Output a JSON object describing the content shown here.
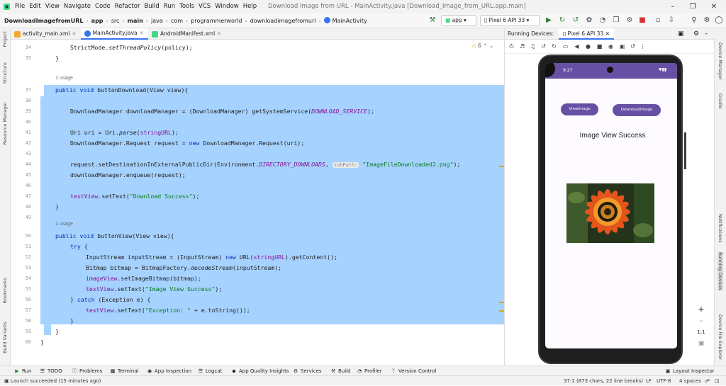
{
  "window": {
    "title": "Download Image from URL - MainActivity.java [Download_Image_from_URL.app.main]",
    "menu": [
      "File",
      "Edit",
      "View",
      "Navigate",
      "Code",
      "Refactor",
      "Build",
      "Run",
      "Tools",
      "VCS",
      "Window",
      "Help"
    ]
  },
  "nav": {
    "breadcrumbs": [
      "DownloadImagefromURL",
      "app",
      "src",
      "main",
      "java",
      "com",
      "programmerworld",
      "downloadimagefromurl",
      "MainActivity"
    ],
    "run_config": "app",
    "device": "Pixel 6 API 33"
  },
  "editor": {
    "tabs": [
      "activity_main.xml",
      "MainActivity.java",
      "AndroidManifest.xml"
    ],
    "active_tab": 1,
    "warning_count": "6",
    "usage_label_1": "1 usage",
    "usage_label_2": "1 usage",
    "param_hint": "subPath:",
    "lines": [
      {
        "n": "34",
        "text": "StrictMode.setThreadPolicy(policy);"
      },
      {
        "n": "35",
        "text": "}"
      },
      {
        "n": "37",
        "text": "public void buttonDownload(View view){"
      },
      {
        "n": "38",
        "text": ""
      },
      {
        "n": "39",
        "text": "DownloadManager downloadManager = (DownloadManager) getSystemService(DOWNLOAD_SERVICE);"
      },
      {
        "n": "40",
        "text": ""
      },
      {
        "n": "41",
        "text": "Uri uri = Uri.parse(stringURL);"
      },
      {
        "n": "42",
        "text": "DownloadManager.Request request = new DownloadManager.Request(uri);"
      },
      {
        "n": "43",
        "text": ""
      },
      {
        "n": "44",
        "text": "request.setDestinationInExternalPublicDir(Environment.DIRECTORY_DOWNLOADS, \"ImageFileDownloaded2.png\");"
      },
      {
        "n": "45",
        "text": "downloadManager.enqueue(request);"
      },
      {
        "n": "46",
        "text": ""
      },
      {
        "n": "47",
        "text": "textView.setText(\"Download Success\");"
      },
      {
        "n": "48",
        "text": "}"
      },
      {
        "n": "49",
        "text": ""
      },
      {
        "n": "50",
        "text": "public void buttonView(View view){"
      },
      {
        "n": "51",
        "text": "try {"
      },
      {
        "n": "52",
        "text": "InputStream inputStream = (InputStream) new URL(stringURL).getContent();"
      },
      {
        "n": "53",
        "text": "Bitmap bitmap = BitmapFactory.decodeStream(inputStream);"
      },
      {
        "n": "54",
        "text": "imageView.setImageBitmap(bitmap);"
      },
      {
        "n": "55",
        "text": "textView.setText(\"Image View Success\");"
      },
      {
        "n": "56",
        "text": "} catch (Exception e) {"
      },
      {
        "n": "57",
        "text": "textView.setText(\"Exception: \" + e.toString());"
      },
      {
        "n": "58",
        "text": "}"
      },
      {
        "n": "59",
        "text": "}"
      },
      {
        "n": "60",
        "text": "}"
      }
    ]
  },
  "devices": {
    "label": "Running Devices:",
    "tab": "Pixel 6 API 33",
    "phone": {
      "time": "9:27",
      "view_button": "ViewImage",
      "download_button": "DownloadImage",
      "result_text": "Image View Success"
    },
    "zoom_ratio": "1:1"
  },
  "left_strip": [
    "Project",
    "Structure",
    "Resource Manager",
    "Bookmarks",
    "Build Variants"
  ],
  "right_strip": [
    "Device Manager",
    "Gradle",
    "Notifications",
    "Running Devices",
    "Device File Explorer"
  ],
  "bottom_tools": [
    "Run",
    "TODO",
    "Problems",
    "Terminal",
    "App Inspection",
    "Logcat",
    "App Quality Insights",
    "Services",
    "Build",
    "Profiler",
    "Version Control",
    "Layout Inspector"
  ],
  "status": {
    "message": "Launch succeeded (15 minutes ago)",
    "position": "37:1 (873 chars, 22 line breaks)",
    "line_sep": "LF",
    "encoding": "UTF-8",
    "indent": "4 spaces"
  }
}
